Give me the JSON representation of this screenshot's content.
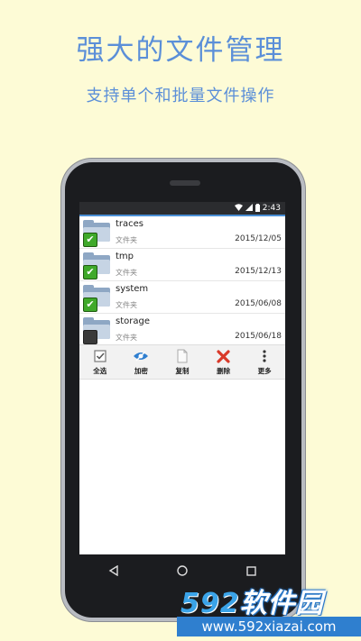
{
  "promo": {
    "headline": "强大的文件管理",
    "subline": "支持单个和批量文件操作"
  },
  "status_bar": {
    "time": "2:43",
    "icons": [
      "wifi-icon",
      "signal-icon",
      "battery-icon"
    ]
  },
  "files": [
    {
      "name": "traces",
      "type": "文件夹",
      "date": "2015/12/05",
      "checked": true
    },
    {
      "name": "tmp",
      "type": "文件夹",
      "date": "2015/12/13",
      "checked": true
    },
    {
      "name": "system",
      "type": "文件夹",
      "date": "2015/06/08",
      "checked": true
    },
    {
      "name": "storage",
      "type": "文件夹",
      "date": "2015/06/18",
      "checked": false
    }
  ],
  "toolbar": {
    "select_all": "全选",
    "encrypt": "加密",
    "copy": "复制",
    "delete": "删除",
    "more": "更多"
  },
  "watermark": {
    "logo_number": "592",
    "logo_text": "软件园",
    "url": "www.592xiazai.com"
  },
  "colors": {
    "background": "#fdfbd6",
    "headline": "#5b8fd8",
    "checkbox_on": "#3fa92a",
    "delete_icon": "#d93a2a",
    "encrypt_icon": "#2f7fd0"
  }
}
